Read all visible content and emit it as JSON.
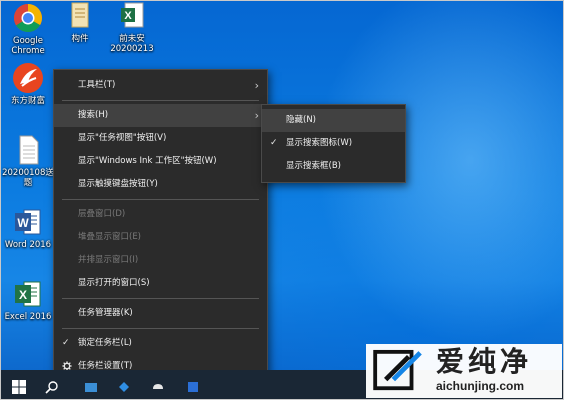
{
  "desktop_icons": [
    {
      "name": "chrome",
      "label": "Google",
      "label2": "Chrome"
    },
    {
      "name": "folder-component",
      "label": "构件",
      "label2": ""
    },
    {
      "name": "excel-file",
      "label": "前未安",
      "label2": "20200213"
    },
    {
      "name": "eastmoney",
      "label": "东方财富",
      "label2": ""
    },
    {
      "name": "text-document",
      "label": "20200108送",
      "label2": "题"
    },
    {
      "name": "word-2016",
      "label": "Word 2016",
      "label2": ""
    },
    {
      "name": "excel-2016",
      "label": "Excel 2016",
      "label2": ""
    }
  ],
  "context_menu": {
    "items": [
      {
        "label": "工具栏(T)",
        "submenu": true
      },
      {
        "separator": true
      },
      {
        "label": "搜索(H)",
        "submenu": true,
        "hover": true
      },
      {
        "label": "显示\"任务视图\"按钮(V)"
      },
      {
        "label": "显示\"Windows Ink 工作区\"按钮(W)"
      },
      {
        "label": "显示触摸键盘按钮(Y)"
      },
      {
        "separator": true
      },
      {
        "label": "层叠窗口(D)",
        "disabled": true
      },
      {
        "label": "堆叠显示窗口(E)",
        "disabled": true
      },
      {
        "label": "并排显示窗口(I)",
        "disabled": true
      },
      {
        "label": "显示打开的窗口(S)"
      },
      {
        "separator": true
      },
      {
        "label": "任务管理器(K)"
      },
      {
        "separator": true
      },
      {
        "label": "锁定任务栏(L)",
        "checked": true
      },
      {
        "label": "任务栏设置(T)",
        "icon": "gear-icon"
      }
    ]
  },
  "search_submenu": {
    "items": [
      {
        "label": "隐藏(N)",
        "hover": true
      },
      {
        "label": "显示搜索图标(W)",
        "checked": true
      },
      {
        "label": "显示搜索框(B)"
      }
    ]
  },
  "watermark": {
    "title": "爱纯净",
    "url": "aichunjing.com"
  },
  "colors": {
    "menu_bg": "#2b2b2b",
    "menu_hover": "#414141",
    "taskbar": "#1a2735",
    "desktop_blue": "#0b7be0"
  }
}
